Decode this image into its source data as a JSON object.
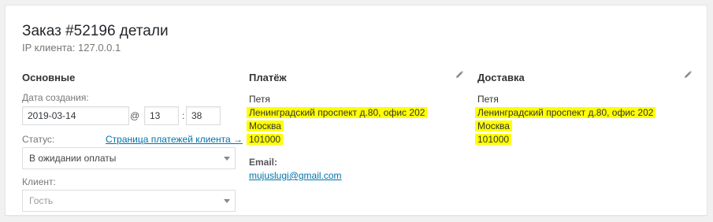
{
  "order": {
    "title": "Заказ #52196 детали",
    "client_ip": "IP клиента: 127.0.0.1"
  },
  "general": {
    "heading": "Основные",
    "date_label": "Дата создания:",
    "date_value": "2019-03-14",
    "at_sign": "@",
    "hour_value": "13",
    "time_sep": ":",
    "minute_value": "38",
    "status_label": "Статус:",
    "payments_link": "Страница платежей клиента →",
    "status_value": "В ожидании оплаты",
    "client_label": "Клиент:",
    "client_value": "Гость"
  },
  "billing": {
    "heading": "Платёж",
    "name": "Петя",
    "address": "Ленинградский проспект д.80, офис 202",
    "city": "Москва",
    "postcode": "101000",
    "email_label": "Email:",
    "email": "mujuslugi@gmail.com"
  },
  "shipping": {
    "heading": "Доставка",
    "name": "Петя",
    "address": "Ленинградский проспект д.80, офис 202",
    "city": "Москва",
    "postcode": "101000"
  },
  "icons": {
    "billing_edit": "pencil-icon",
    "shipping_edit": "pencil-icon",
    "status_dropdown": "chevron-down-icon",
    "client_dropdown": "chevron-down-icon"
  },
  "colors": {
    "highlight": "#ffff00",
    "link": "#0073aa"
  }
}
